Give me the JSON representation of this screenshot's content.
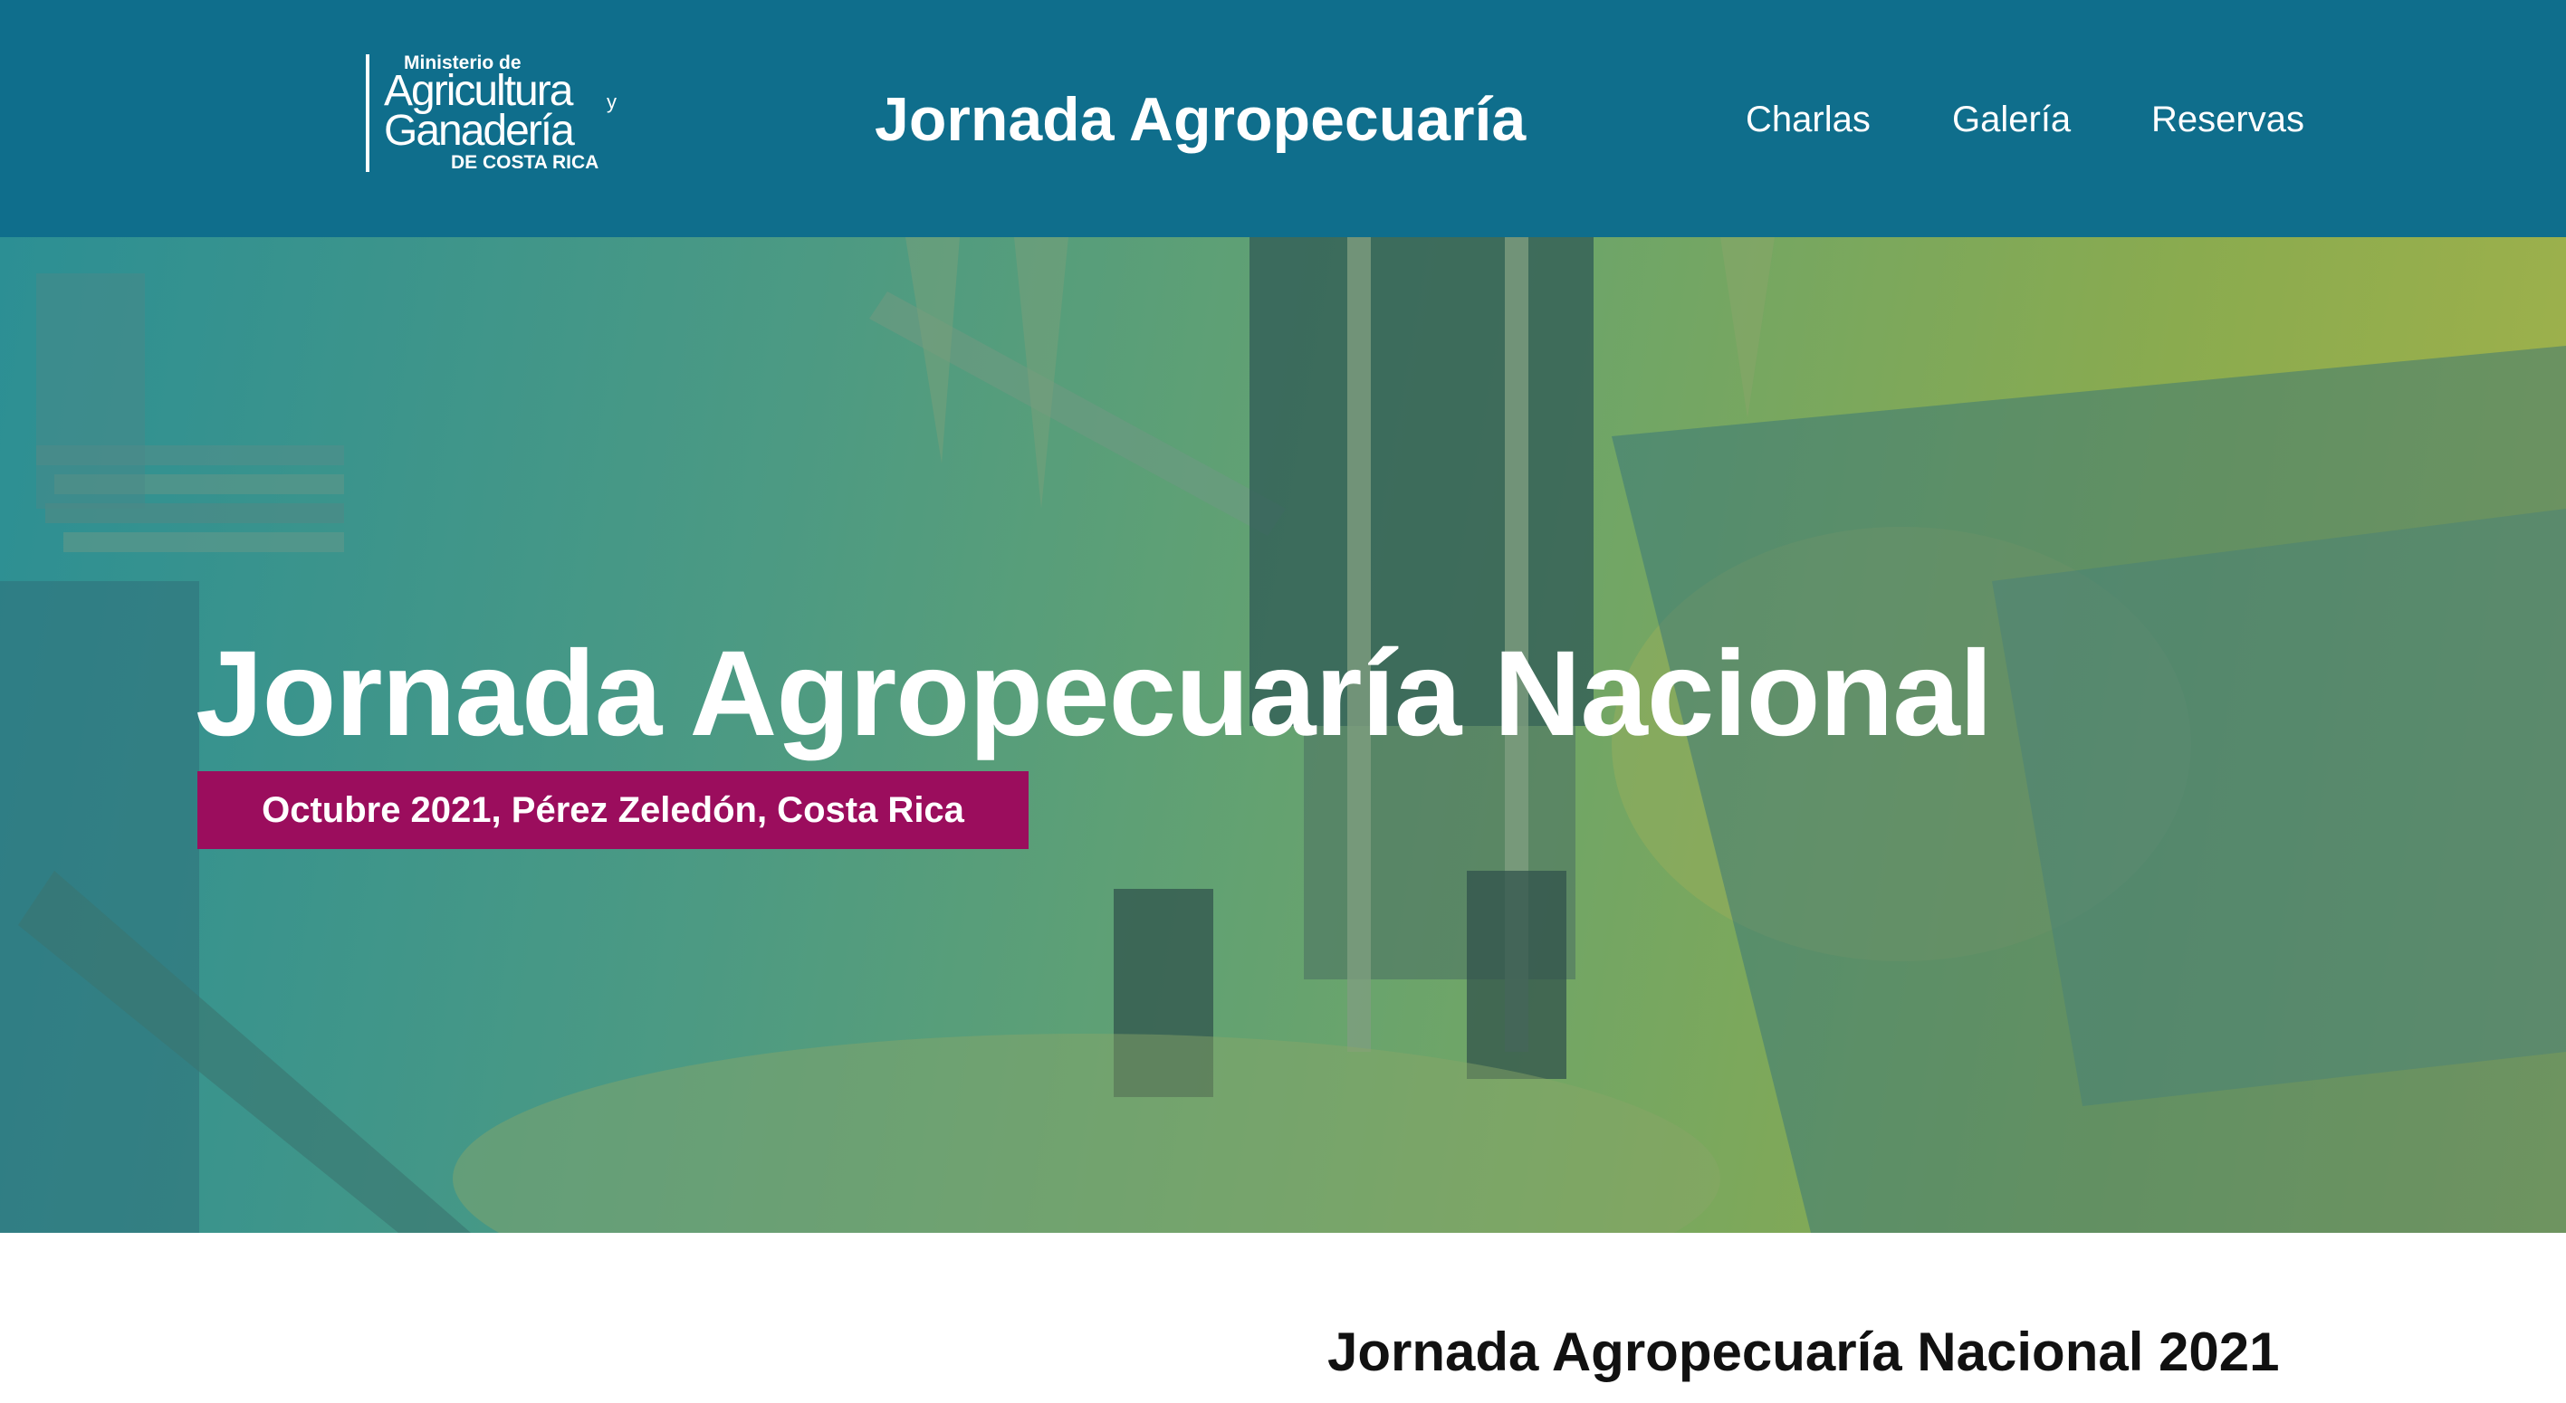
{
  "header": {
    "logo": {
      "line1": "Ministerio de",
      "line2": "Agricultura",
      "line2_suffix": "y",
      "line3": "Ganadería",
      "line4": "DE COSTA RICA"
    },
    "site_title": "Jornada Agropecuaría",
    "nav": [
      "Charlas",
      "Galería",
      "Reservas"
    ]
  },
  "hero": {
    "title": "Jornada Agropecuaría Nacional",
    "subtitle": "Octubre 2021, Pérez Zeledón, Costa Rica"
  },
  "section": {
    "title": "Jornada Agropecuaría Nacional 2021"
  },
  "colors": {
    "header_bg": "#0f6e8c",
    "badge_bg": "#9b0d5d",
    "hero_overlay_start": "#2c8f94",
    "hero_overlay_end": "#a3b24a"
  }
}
